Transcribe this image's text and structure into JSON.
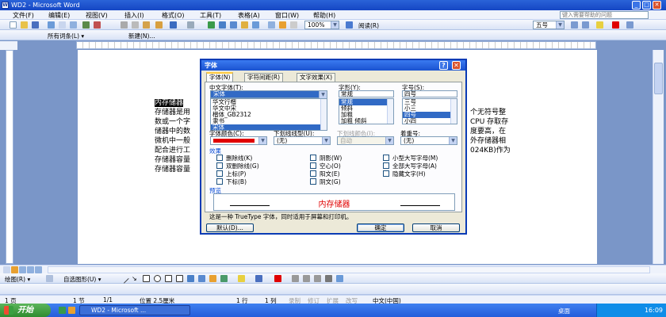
{
  "window": {
    "title": "WD2 - Microsoft Word",
    "minimize": "_",
    "maximize": "□",
    "close": "✕"
  },
  "menu": {
    "items": [
      "文件(F)",
      "编辑(E)",
      "视图(V)",
      "插入(I)",
      "格式(O)",
      "工具(T)",
      "表格(A)",
      "窗口(W)",
      "帮助(H)"
    ],
    "help_placeholder": "键入需要帮助的问题"
  },
  "toolbar": {
    "zoom": "100%",
    "font_size": "五号",
    "read_label": "阅读(R)"
  },
  "toolbar2": {
    "all_entries": "所有词条(L) ▾",
    "new": "新建(N)..."
  },
  "document": {
    "selected_heading": "内存储器",
    "lines": [
      "存储器是用",
      "数或一个字",
      "储器中的数",
      "微机中一般",
      "配合进行工",
      "存储器容量",
      "存储器容量"
    ],
    "right_lines": [
      "个无符号整",
      "CPU 存取存",
      "度要高，在",
      "外存储器相",
      "",
      "024KB)作为",
      ""
    ]
  },
  "dialog": {
    "title": "字体",
    "help_btn": "?",
    "close_btn": "✕",
    "tabs": [
      "字体(N)",
      "字符间距(R)",
      "文字效果(X)"
    ],
    "cn_font_label": "中文字体(T):",
    "cn_font_value": "宋体",
    "cn_font_list": [
      "华文行楷",
      "华文中宋",
      "楷体_GB2312",
      "隶书",
      "宋体"
    ],
    "style_label": "字形(Y):",
    "style_value": "常规",
    "style_list": [
      "常规",
      "倾斜",
      "加粗",
      "加粗 倾斜"
    ],
    "size_label": "字号(S):",
    "size_value": "四号",
    "size_list": [
      "三号",
      "小三",
      "四号",
      "小四",
      "五号"
    ],
    "color_label": "字体颜色(C):",
    "font_color": "#e00000",
    "underline_label": "下划线线型(U):",
    "underline_value": "(无)",
    "underline_color_label": "下划线颜色(I):",
    "underline_color_value": "自动",
    "emphasis_label": "着重号:",
    "emphasis_value": "(无)",
    "effects_label": "效果",
    "effects": [
      [
        "删除线(K)",
        "阴影(W)",
        "小型大写字母(M)"
      ],
      [
        "双删除线(G)",
        "空心(O)",
        "全部大写字母(A)"
      ],
      [
        "上标(P)",
        "阳文(E)",
        "隐藏文字(H)"
      ],
      [
        "下标(B)",
        "阴文(G)",
        ""
      ]
    ],
    "preview_label": "预览",
    "preview_text": "内存储器",
    "preview_color": "#e00000",
    "info_text": "这是一种 TrueType 字体，同时适用于屏幕和打印机。",
    "default_btn": "默认(D)...",
    "ok_btn": "确定",
    "cancel_btn": "取消"
  },
  "drawing": {
    "draw_label": "绘图(R) ▾",
    "autoshape_label": "自选图形(U) ▾"
  },
  "status": {
    "page": "1 页",
    "section": "1 节",
    "pages": "1/1",
    "position": "位置 2.5厘米",
    "line": "1 行",
    "col": "1 列",
    "modes": [
      "录制",
      "修订",
      "扩展",
      "改写"
    ],
    "lang": "中文(中国)"
  },
  "taskbar": {
    "start": "开始",
    "tasks": [
      "WD2 - Microsoft ..."
    ],
    "right_label": "桌面",
    "time": "16:09"
  }
}
